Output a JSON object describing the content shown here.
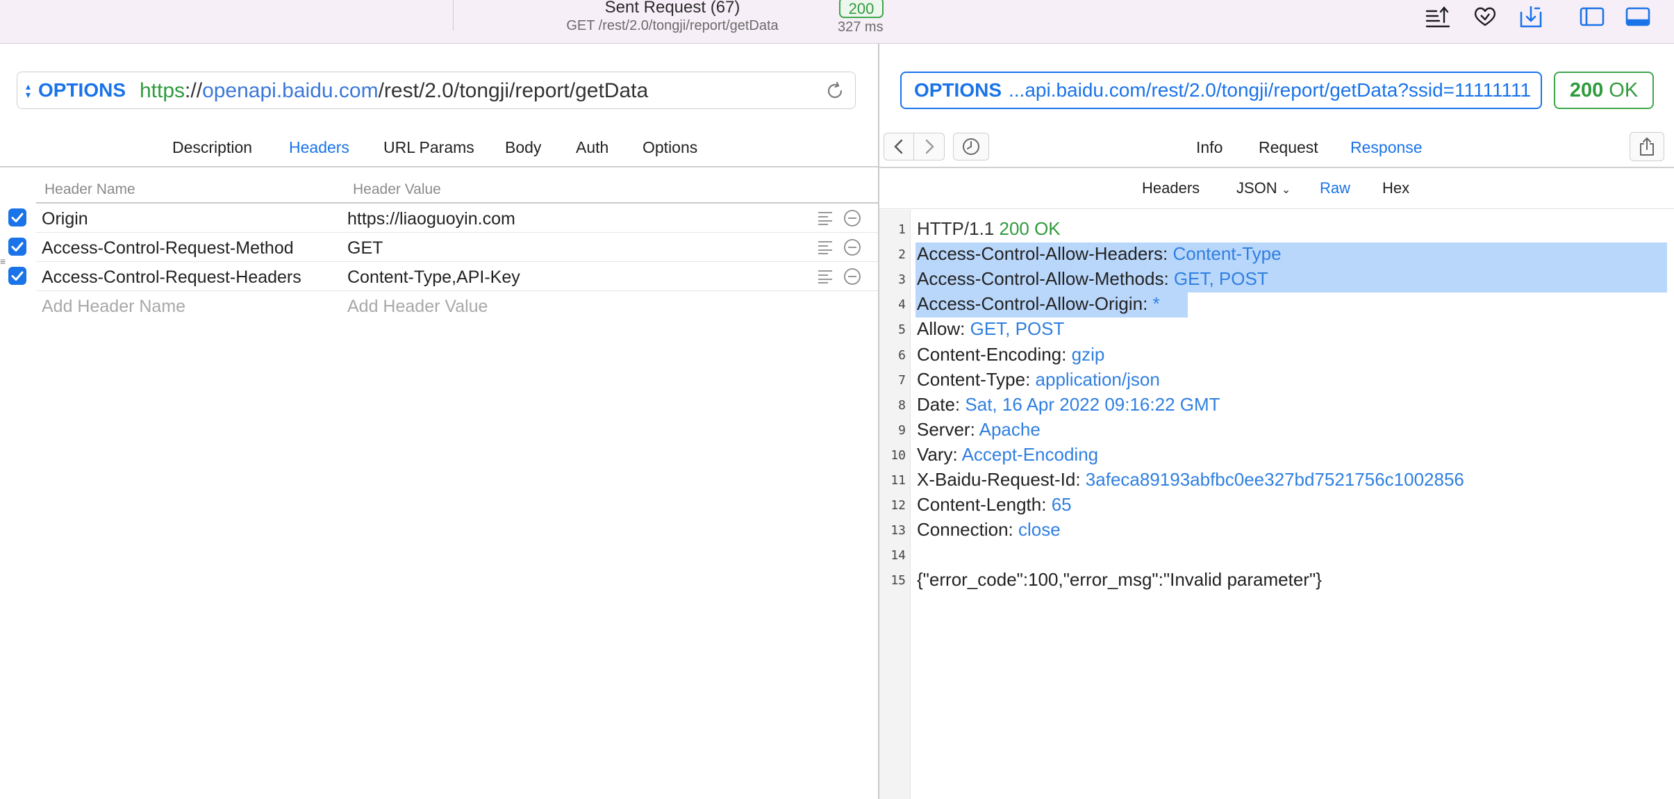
{
  "titlebar": {
    "title": "Sent Request (67)",
    "subtitle": "GET /rest/2.0/tongji/report/getData",
    "status_badge": "200",
    "time": "327 ms",
    "icons": [
      "upload-list-icon",
      "cloud-heart-icon",
      "import-icon",
      "left-sidebar-icon",
      "bottom-panel-icon"
    ]
  },
  "request": {
    "method": "OPTIONS",
    "url_scheme": "https",
    "url_sep": "://",
    "url_host": "openapi.baidu.com",
    "url_path": "/rest/2.0/tongji/report/getData",
    "tabs": [
      "Description",
      "Headers",
      "URL Params",
      "Body",
      "Auth",
      "Options"
    ],
    "active_tab": "Headers",
    "headers_table": {
      "col_name": "Header Name",
      "col_value": "Header Value",
      "rows": [
        {
          "name": "Origin",
          "value": "https://liaoguoyin.com",
          "checked": true
        },
        {
          "name": "Access-Control-Request-Method",
          "value": "GET",
          "checked": true
        },
        {
          "name": "Access-Control-Request-Headers",
          "value": "Content-Type,API-Key",
          "checked": true
        }
      ],
      "add_name_placeholder": "Add Header Name",
      "add_value_placeholder": "Add Header Value"
    }
  },
  "response": {
    "method": "OPTIONS",
    "url": "...api.baidu.com/rest/2.0/tongji/report/getData?ssid=11111111",
    "status_code": "200",
    "status_text": "OK",
    "tabs": [
      "Info",
      "Request",
      "Response"
    ],
    "active_tab": "Response",
    "sub_tabs": [
      "Headers",
      "JSON",
      "Raw",
      "Hex"
    ],
    "active_sub_tab": "Raw",
    "lines": [
      {
        "n": "1",
        "key": "HTTP/1.1",
        "sep": " ",
        "val": "200 OK",
        "style": "status"
      },
      {
        "n": "2",
        "key": "Access-Control-Allow-Headers:",
        "sep": " ",
        "val": "Content-Type",
        "hl": true
      },
      {
        "n": "3",
        "key": "Access-Control-Allow-Methods:",
        "sep": " ",
        "val": "GET, POST",
        "hl": true
      },
      {
        "n": "4",
        "key": "Access-Control-Allow-Origin:",
        "sep": " ",
        "val": "*",
        "hl": true
      },
      {
        "n": "5",
        "key": "Allow:",
        "sep": " ",
        "val": "GET, POST"
      },
      {
        "n": "6",
        "key": "Content-Encoding:",
        "sep": " ",
        "val": "gzip"
      },
      {
        "n": "7",
        "key": "Content-Type:",
        "sep": " ",
        "val": "application/json"
      },
      {
        "n": "8",
        "key": "Date:",
        "sep": " ",
        "val": "Sat, 16 Apr 2022 09:16:22 GMT"
      },
      {
        "n": "9",
        "key": "Server:",
        "sep": " ",
        "val": "Apache"
      },
      {
        "n": "10",
        "key": "Vary:",
        "sep": " ",
        "val": "Accept-Encoding"
      },
      {
        "n": "11",
        "key": "X-Baidu-Request-Id:",
        "sep": " ",
        "val": "3afeca89193abfbc0ee327bd7521756c1002856"
      },
      {
        "n": "12",
        "key": "Content-Length:",
        "sep": " ",
        "val": "65"
      },
      {
        "n": "13",
        "key": "Connection:",
        "sep": " ",
        "val": "close"
      },
      {
        "n": "14",
        "key": "",
        "sep": "",
        "val": ""
      },
      {
        "n": "15",
        "key": "{\"error_code\":100,\"error_msg\":\"Invalid parameter\"}",
        "sep": "",
        "val": ""
      }
    ]
  },
  "colors": {
    "accent": "#1a73e8",
    "success": "#2f9b3c",
    "highlight": "#b9d7fb",
    "titlebar_bg": "#f7eff7"
  }
}
